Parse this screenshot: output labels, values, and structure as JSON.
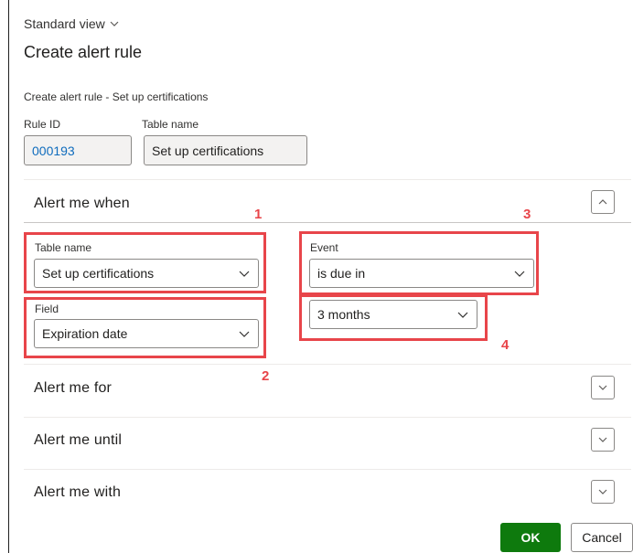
{
  "header": {
    "view_label": "Standard view",
    "title": "Create alert rule",
    "subtitle": "Create alert rule - Set up certifications"
  },
  "rule": {
    "rule_id_label": "Rule ID",
    "rule_id_value": "000193",
    "table_name_label": "Table name",
    "table_name_value": "Set up certifications"
  },
  "alert_me_when": {
    "heading": "Alert me when",
    "table_name_label": "Table name",
    "table_name_value": "Set up certifications",
    "field_label": "Field",
    "field_value": "Expiration date",
    "event_label": "Event",
    "event_value": "is due in",
    "period_value": "3 months"
  },
  "sections": {
    "alert_me_for": "Alert me for",
    "alert_me_until": "Alert me until",
    "alert_me_with": "Alert me with"
  },
  "annotations": {
    "n1": "1",
    "n2": "2",
    "n3": "3",
    "n4": "4"
  },
  "footer": {
    "ok_label": "OK",
    "cancel_label": "Cancel"
  },
  "colors": {
    "highlight": "#e8454a",
    "ok_button": "#0e7a0d",
    "link_value": "#0f6cbd"
  },
  "icons": {
    "view_switch": "chevron-down-icon",
    "expanded_section": "chevron-up-icon",
    "collapsed_section": "chevron-down-icon"
  }
}
